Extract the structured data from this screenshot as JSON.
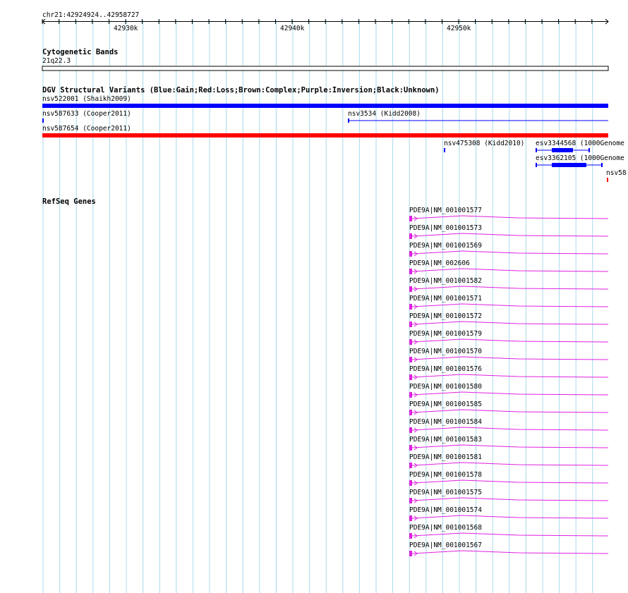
{
  "ruler": {
    "region": "chr21:42924924..42958727",
    "ticks": [
      "42930k",
      "42940k",
      "42950k"
    ]
  },
  "tracks": {
    "cytoband": {
      "title": "Cytogenetic Bands",
      "band": "21q22.3"
    },
    "dgv": {
      "title": "DGV Structural Variants (Blue:Gain;Red:Loss;Brown:Complex;Purple:Inversion;Black:Unknown)",
      "features": [
        {
          "label": "nsv522001 (Shaikh2009)",
          "color": "#0000ff"
        },
        {
          "label": "nsv587633 (Cooper2011)",
          "color": "#0000ff"
        },
        {
          "label": "nsv3534 (Kidd2008)",
          "color": "#0000ff"
        },
        {
          "label": "nsv587654 (Cooper2011)",
          "color": "#ff0000"
        },
        {
          "label": "nsv475308 (Kidd2010)",
          "color": "#0000ff"
        },
        {
          "label": "esv3344568 (1000Genome",
          "color": "#0000ff"
        },
        {
          "label": "esv3362105 (1000Genome",
          "color": "#0000ff"
        },
        {
          "label": "nsv58",
          "color": "#ff0000"
        }
      ]
    },
    "refseq": {
      "title": "RefSeq Genes",
      "color": "#e020e0",
      "genes": [
        "PDE9A|NM_001001577",
        "PDE9A|NM_001001573",
        "PDE9A|NM_001001569",
        "PDE9A|NM_002606",
        "PDE9A|NM_001001582",
        "PDE9A|NM_001001571",
        "PDE9A|NM_001001572",
        "PDE9A|NM_001001579",
        "PDE9A|NM_001001570",
        "PDE9A|NM_001001576",
        "PDE9A|NM_001001580",
        "PDE9A|NM_001001585",
        "PDE9A|NM_001001584",
        "PDE9A|NM_001001583",
        "PDE9A|NM_001001581",
        "PDE9A|NM_001001578",
        "PDE9A|NM_001001575",
        "PDE9A|NM_001001574",
        "PDE9A|NM_001001568",
        "PDE9A|NM_001001567"
      ]
    }
  }
}
